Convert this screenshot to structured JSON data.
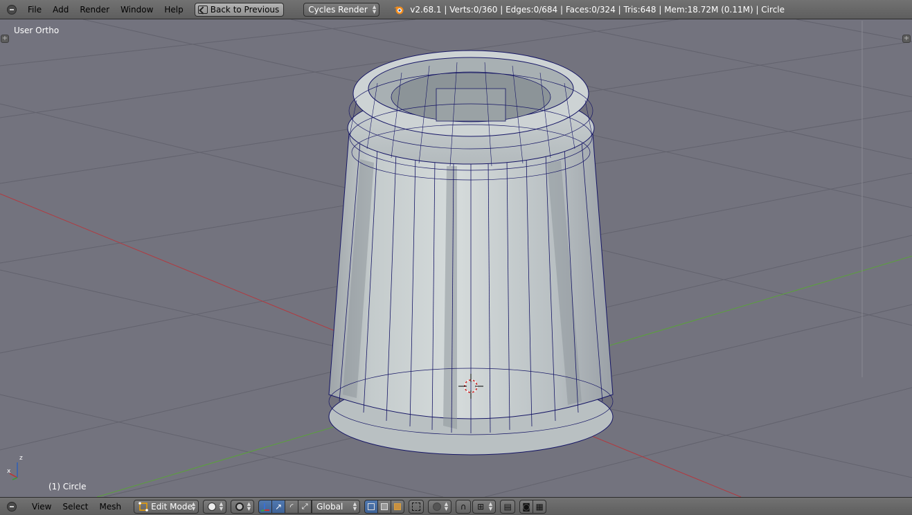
{
  "top_header": {
    "menus": [
      "File",
      "Add",
      "Render",
      "Window",
      "Help"
    ],
    "back_button": "Back to Previous",
    "render_engine": "Cycles Render",
    "stats": "v2.68.1 | Verts:0/360 | Edges:0/684 | Faces:0/324 | Tris:648 | Mem:18.72M (0.11M) | Circle"
  },
  "viewport": {
    "view_label": "User Ortho",
    "object_label": "(1) Circle",
    "axis_labels": {
      "z": "z",
      "x": "x"
    }
  },
  "bottom_header": {
    "menus": [
      "View",
      "Select",
      "Mesh"
    ],
    "mode": "Edit Mode",
    "transform_orientation": "Global"
  },
  "colors": {
    "viewport_bg": "#73737e",
    "grid": "#5f5f6a",
    "x_axis": "#b4383e",
    "y_axis": "#5aa23a",
    "mesh_edge": "#141464",
    "header_bg": "#6a6a6a",
    "active_button": "#4a73aa"
  }
}
